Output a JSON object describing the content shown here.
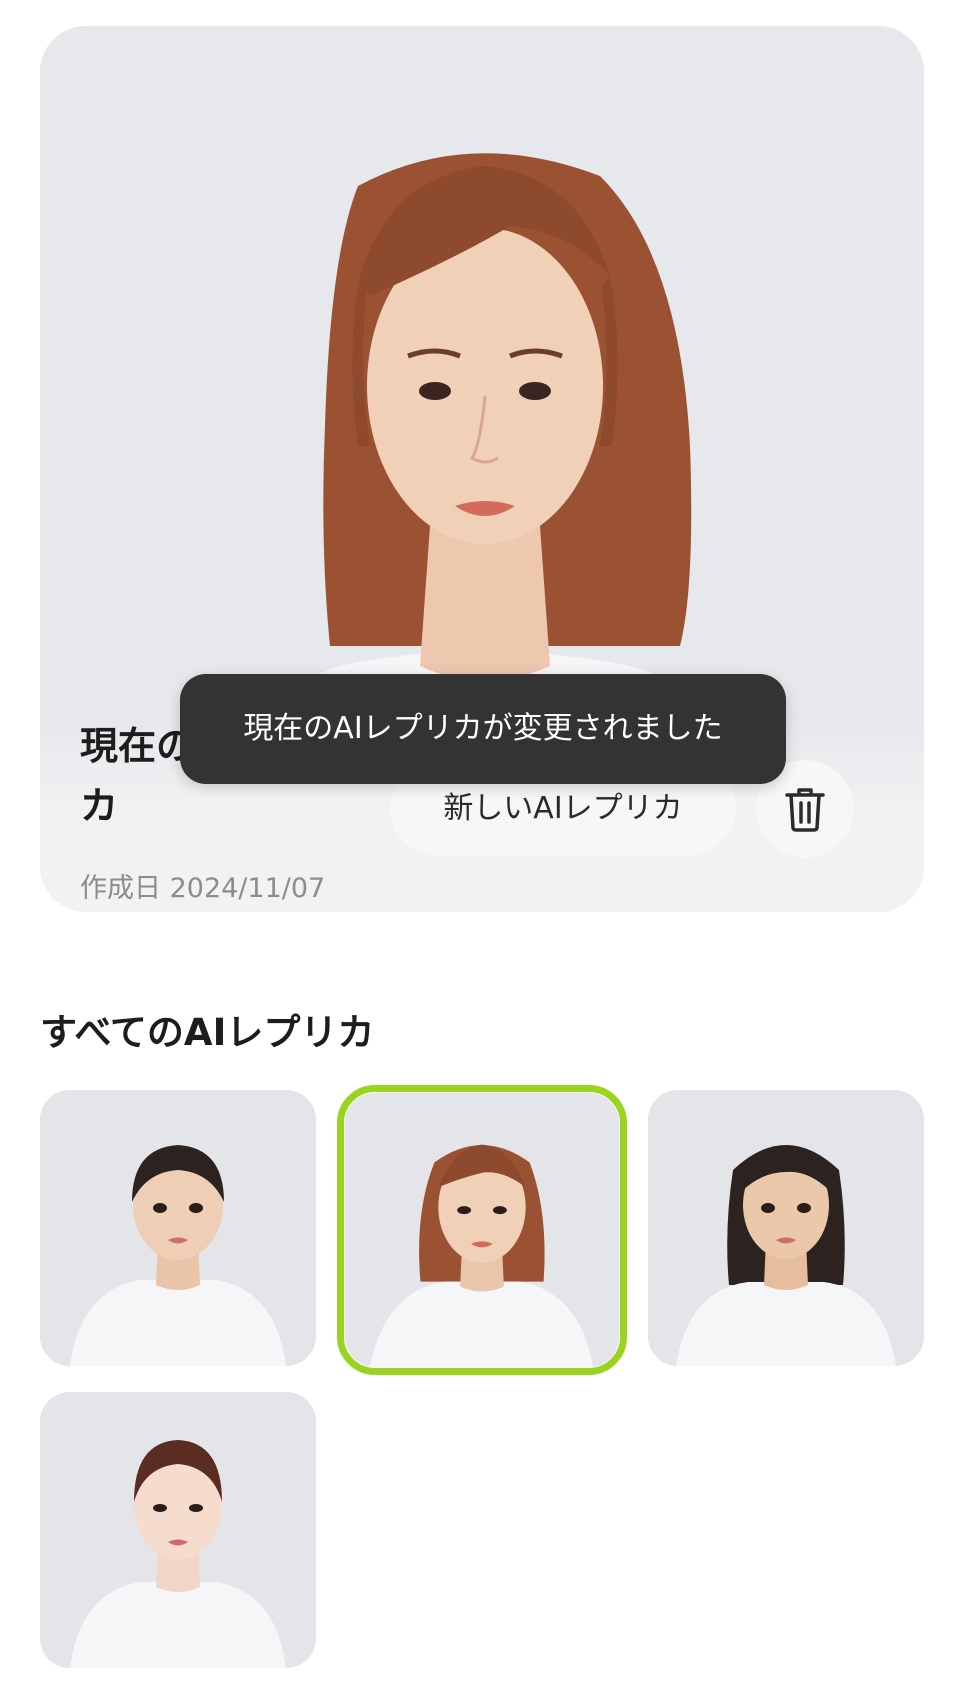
{
  "current_replica": {
    "title": "現在のAIレプリカ",
    "created_date": "作成日 2024/11/07",
    "portrait_icon": "woman-auburn-hair-portrait"
  },
  "toast": {
    "message": "現在のAIレプリカが変更されました"
  },
  "actions": {
    "new_replica_label": "新しいAIレプリカ",
    "delete_icon": "trash-icon"
  },
  "all_replicas": {
    "heading": "すべてのAIレプリカ",
    "items": [
      {
        "icon": "girl-ponytail-portrait",
        "selected": false
      },
      {
        "icon": "woman-auburn-hair-portrait",
        "selected": true
      },
      {
        "icon": "girl-long-hair-portrait",
        "selected": false
      },
      {
        "icon": "woman-tied-hair-portrait",
        "selected": false
      }
    ]
  },
  "colors": {
    "selected_ring": "#9ad420",
    "toast_bg": "#333333",
    "card_bg": "#e8e9ec",
    "hair_auburn": "#9a5232",
    "hair_dark": "#2c2320"
  }
}
